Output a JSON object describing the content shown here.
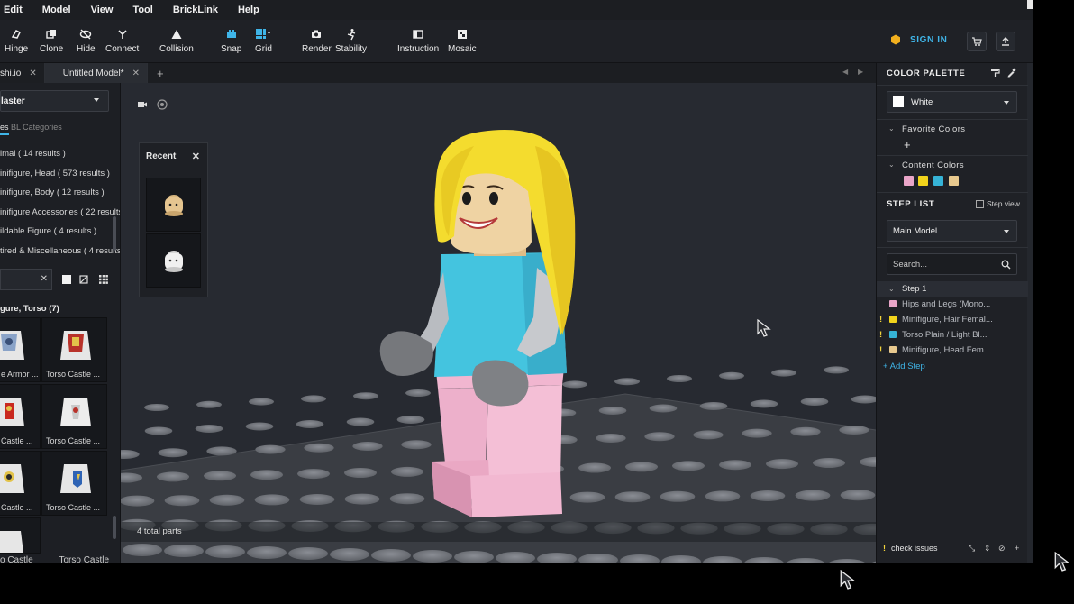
{
  "menu": [
    "Edit",
    "Model",
    "View",
    "Tool",
    "BrickLink",
    "Help"
  ],
  "toolbar": {
    "tools": [
      {
        "label": "Hinge",
        "icon": "hinge-icon"
      },
      {
        "label": "Clone",
        "icon": "clone-icon"
      },
      {
        "label": "Hide",
        "icon": "hide-icon"
      },
      {
        "label": "Connect",
        "icon": "connect-icon"
      },
      {
        "label": "Collision",
        "icon": "collision-icon"
      },
      {
        "label": "Snap",
        "icon": "snap-icon"
      },
      {
        "label": "Grid",
        "icon": "grid-icon"
      },
      {
        "label": "Render",
        "icon": "render-icon"
      },
      {
        "label": "Stability",
        "icon": "stability-icon"
      },
      {
        "label": "Instruction",
        "icon": "instruction-icon"
      },
      {
        "label": "Mosaic",
        "icon": "mosaic-icon"
      }
    ],
    "sign_in": "SIGN IN",
    "snap_active_color": "#3fb5e8"
  },
  "tabs": [
    {
      "label": "shi.io",
      "close": "✕"
    },
    {
      "label": "Untitled Model*",
      "close": "✕"
    }
  ],
  "tab_add": "+",
  "left_panel": {
    "library_select": "laster",
    "tabs": [
      "es",
      "BL Categories"
    ],
    "categories": [
      "imal ( 14 results )",
      "inifigure, Head ( 573 results )",
      "inifigure, Body ( 12 results )",
      "inifigure Accessories ( 22 results )",
      "ildable Figure ( 4 results )",
      "tired & Miscellaneous ( 4 results )"
    ],
    "result_title": "gure, Torso (7)",
    "parts": [
      {
        "label": "e Armor ..."
      },
      {
        "label": "Torso Castle ..."
      },
      {
        "label": "Castle ..."
      },
      {
        "label": "Torso Castle ..."
      },
      {
        "label": "Castle ..."
      },
      {
        "label": "Torso Castle ..."
      }
    ],
    "bottom_labels": [
      "o Castle",
      "Torso Castle"
    ]
  },
  "viewport": {
    "recent_title": "Recent",
    "status": "4 total parts"
  },
  "right_panel": {
    "color_palette_title": "COLOR PALETTE",
    "selected_color": "White",
    "favorite_colors": "Favorite Colors",
    "content_colors": "Content Colors",
    "content_swatches": [
      "#e9a5c8",
      "#f2d41c",
      "#36b3d6",
      "#e8c98e"
    ],
    "step_list_title": "STEP LIST",
    "step_view": "Step view",
    "model_select": "Main Model",
    "search_placeholder": "Search...",
    "step": "Step 1",
    "items": [
      {
        "label": "Hips and Legs (Mono...",
        "color": "#e9a5c8",
        "warn": false
      },
      {
        "label": "Minifigure, Hair Femal...",
        "color": "#f2d41c",
        "warn": true
      },
      {
        "label": "Torso Plain / Light Bl...",
        "color": "#36b3d6",
        "warn": true
      },
      {
        "label": "Minifigure, Head Fem...",
        "color": "#e8c98e",
        "warn": true
      }
    ],
    "add_step": "+ Add Step",
    "check_issues": "check issues"
  }
}
